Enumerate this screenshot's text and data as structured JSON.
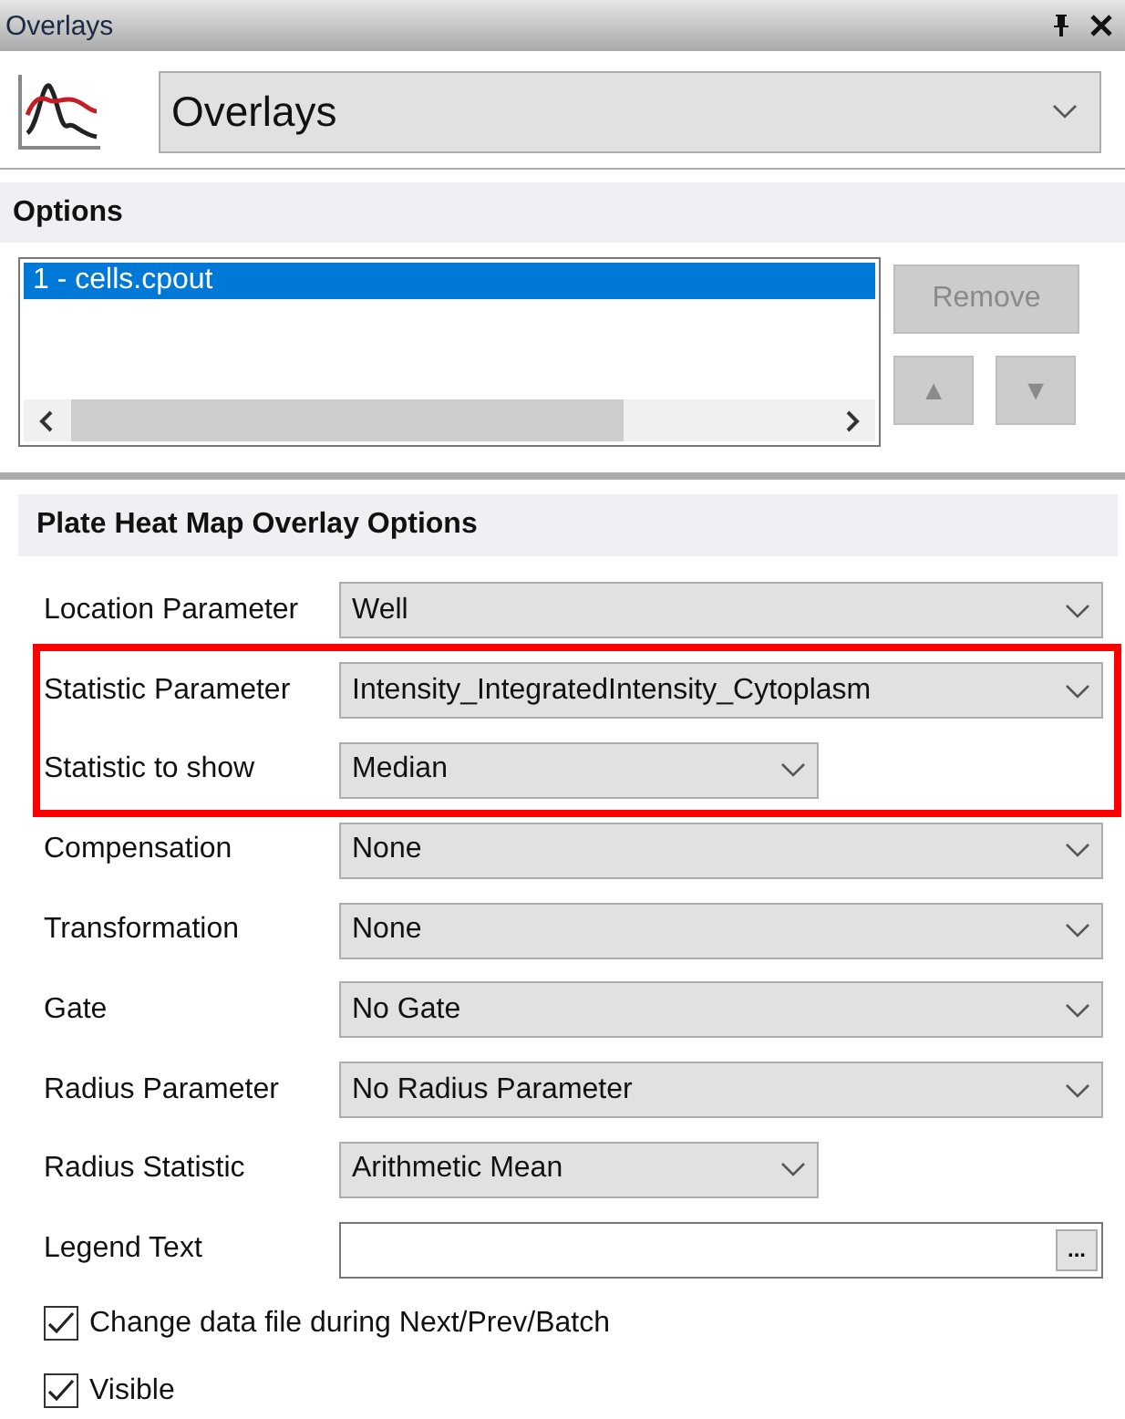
{
  "window": {
    "title": "Overlays"
  },
  "header": {
    "dropdown_value": "Overlays"
  },
  "options": {
    "title": "Options",
    "items": [
      {
        "label": "1 - cells.cpout",
        "selected": true
      }
    ],
    "remove_button": {
      "label": "Remove",
      "disabled": true
    },
    "move_up": {
      "label": "▲",
      "disabled": true
    },
    "move_down": {
      "label": "▼",
      "disabled": true
    }
  },
  "section": {
    "title": "Plate Heat Map Overlay Options"
  },
  "row_groups": [
    {
      "highlighted": false,
      "rows": [
        {
          "kind": "dropdown",
          "label": "Location Parameter",
          "value": "Well"
        }
      ]
    },
    {
      "highlighted": true,
      "rows": [
        {
          "kind": "dropdown",
          "label": "Statistic Parameter",
          "value": "Intensity_IntegratedIntensity_Cytoplasm"
        },
        {
          "kind": "compact-dropdown",
          "label": "Statistic to show",
          "value": "Median"
        }
      ]
    },
    {
      "highlighted": false,
      "rows": [
        {
          "kind": "dropdown",
          "label": "Compensation",
          "value": "None"
        },
        {
          "kind": "dropdown",
          "label": "Transformation",
          "value": "None"
        },
        {
          "kind": "dropdown",
          "label": "Gate",
          "value": "No Gate"
        },
        {
          "kind": "dropdown",
          "label": "Radius Parameter",
          "value": "No Radius Parameter"
        },
        {
          "kind": "compact-dropdown",
          "label": "Radius Statistic",
          "value": "Arithmetic Mean"
        },
        {
          "kind": "text-field",
          "label": "Legend Text",
          "button": "..."
        }
      ]
    }
  ],
  "checkboxes": [
    {
      "label": "Change data file during Next/Prev/Batch",
      "checked": true
    },
    {
      "label": "Visible",
      "checked": true
    }
  ]
}
